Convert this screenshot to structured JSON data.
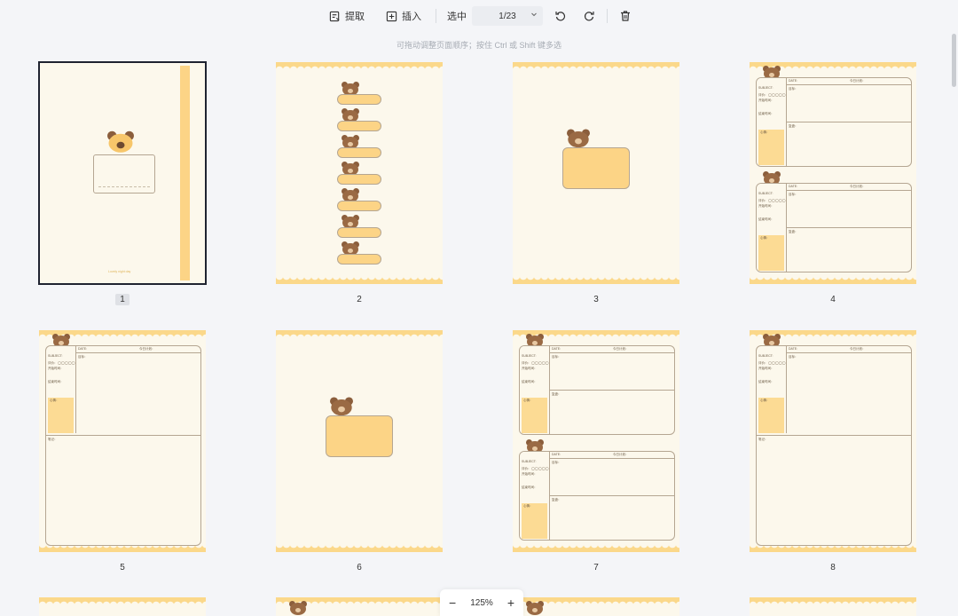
{
  "toolbar": {
    "extract_label": "提取",
    "insert_label": "插入",
    "select_label": "选中",
    "page_indicator": "1/23"
  },
  "hint": "可拖动调整页面顺序；按住 Ctrl 或 Shift 键多选",
  "pages": [
    {
      "number": "1",
      "cover_text": "Lovely night day"
    },
    {
      "number": "2"
    },
    {
      "number": "3"
    },
    {
      "number": "4"
    },
    {
      "number": "5"
    },
    {
      "number": "6"
    },
    {
      "number": "7"
    },
    {
      "number": "8"
    }
  ],
  "planner_labels": {
    "date": "DATE:",
    "schedule": "今日计划：",
    "subject": "SUBJECT:",
    "goal": "目标：",
    "mood": "心情：",
    "review": "复盘：",
    "notes": "笔记：",
    "rating": "评价：",
    "stars": "◯◯◯◯◯",
    "start_time": "开始时间：",
    "end_time": "结束时间："
  },
  "zoom": {
    "value": "125%",
    "minus": "−",
    "plus": "+"
  }
}
